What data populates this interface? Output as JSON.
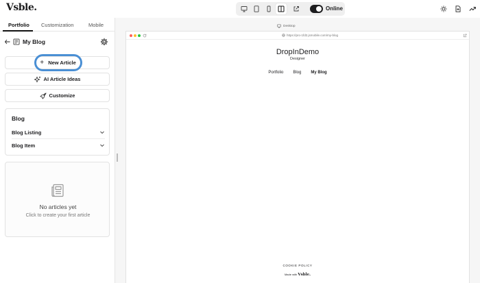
{
  "app": {
    "logo": "Vsble."
  },
  "toolbar": {
    "devices": [
      {
        "name": "desktop",
        "icon": "monitor-icon"
      },
      {
        "name": "tablet",
        "icon": "tablet-icon"
      },
      {
        "name": "mobile",
        "icon": "phone-icon"
      },
      {
        "name": "split",
        "icon": "columns-icon",
        "active": true
      },
      {
        "name": "open-external",
        "icon": "external-link-icon"
      }
    ],
    "online_toggle": {
      "on": true,
      "label": "Online"
    },
    "right_icons": [
      "sun-icon",
      "file-plus-icon",
      "trending-up-icon"
    ]
  },
  "sidebar": {
    "tabs": [
      {
        "label": "Portfolio",
        "active": true
      },
      {
        "label": "Customization"
      },
      {
        "label": "Mobile"
      }
    ],
    "header": {
      "title": "My Blog"
    },
    "actions": {
      "new_article": "New Article",
      "ai_ideas": "AI Article Ideas",
      "customize": "Customize"
    },
    "blog_section": {
      "title": "Blog",
      "items": [
        {
          "label": "Blog Listing"
        },
        {
          "label": "Blog Item"
        }
      ]
    },
    "empty_state": {
      "title": "No articles yet",
      "subtitle": "Click to create your first article"
    }
  },
  "preview": {
    "mode_label": "Desktop",
    "url": "https://pro-1fd2.jsmobile.com/my-blog",
    "site": {
      "name": "DropInDemo",
      "tagline": "Designer",
      "nav": [
        "Portfolio",
        "Blog",
        "My Blog"
      ],
      "nav_current_index": 2,
      "cookie": "COOKIE POLICY",
      "made_with": "Made with",
      "made_with_brand": "Vsble."
    }
  },
  "colors": {
    "accent_ring": "#4a8fd4",
    "dot_red": "#ff5f57",
    "dot_yellow": "#febc2e",
    "dot_green": "#28c840"
  }
}
